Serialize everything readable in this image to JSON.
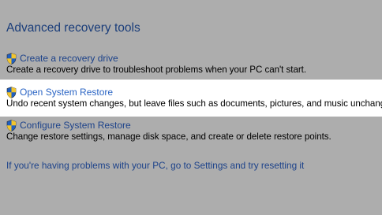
{
  "section": {
    "title": "Advanced recovery tools"
  },
  "tools": [
    {
      "label": "Create a recovery drive",
      "description": "Create a recovery drive to troubleshoot problems when your PC can't start.",
      "icon": "uac-shield-icon"
    },
    {
      "label": "Open System Restore",
      "description": "Undo recent system changes, but leave files such as documents, pictures, and music unchanged.",
      "icon": "uac-shield-icon"
    },
    {
      "label": "Configure System Restore",
      "description": "Change restore settings, manage disk space, and create or delete restore points.",
      "icon": "uac-shield-icon"
    }
  ],
  "footer": {
    "reset_link": "If you're having problems with your PC, go to Settings and try resetting it"
  },
  "colors": {
    "dim_overlay": "#adadad",
    "highlight_background": "#ffffff",
    "title": "#1a3d7a",
    "link": "#1c428a",
    "highlight_link": "#2a64c4"
  }
}
